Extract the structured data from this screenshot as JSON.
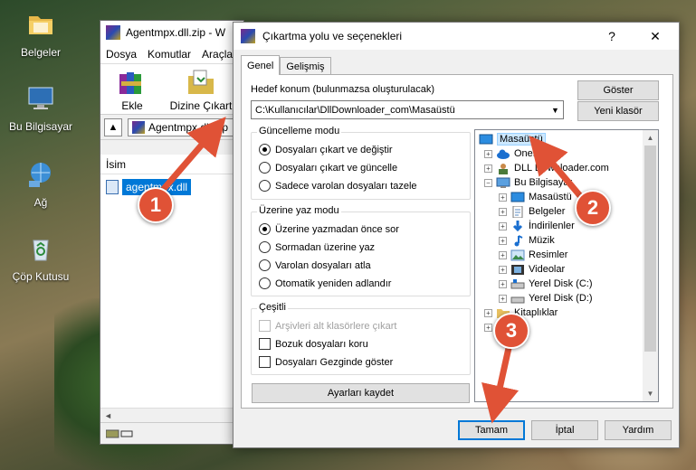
{
  "desktop": {
    "icons": [
      {
        "label": "Belgeler",
        "icon": "folder-icon"
      },
      {
        "label": "Bu Bilgisayar",
        "icon": "computer-icon"
      },
      {
        "label": "Ağ",
        "icon": "network-icon"
      },
      {
        "label": "Çöp Kutusu",
        "icon": "recycle-bin-icon"
      }
    ]
  },
  "winrar": {
    "title": "Agentmpx.dll.zip - W",
    "menu": [
      "Dosya",
      "Komutlar",
      "Araçla"
    ],
    "toolbar": {
      "add": "Ekle",
      "extract_to": "Dizine Çıkart"
    },
    "address": "Agentmpx.dll.zip",
    "list_header": "İsim",
    "file": "agentmpx.dll",
    "scroll_left": "◄"
  },
  "dialog": {
    "title": "Çıkartma yolu ve seçenekleri",
    "help_button": "?",
    "close_button": "✕",
    "tabs": [
      "Genel",
      "Gelişmiş"
    ],
    "destination_label": "Hedef konum (bulunmazsa oluşturulacak)",
    "destination_value": "C:\\Kullanıcılar\\DllDownloader_com\\Masaüstü",
    "show_button": "Göster",
    "new_folder_button": "Yeni klasör",
    "update_mode": {
      "legend": "Güncelleme modu",
      "options": [
        "Dosyaları çıkart ve değiştir",
        "Dosyaları çıkart ve güncelle",
        "Sadece varolan dosyaları tazele"
      ],
      "selected": 0
    },
    "overwrite_mode": {
      "legend": "Üzerine yaz modu",
      "options": [
        "Üzerine yazmadan önce sor",
        "Sormadan üzerine yaz",
        "Varolan dosyaları atla",
        "Otomatik yeniden adlandır"
      ],
      "selected": 0
    },
    "misc": {
      "legend": "Çeşitli",
      "options": [
        "Arşivleri alt klasörlere çıkart",
        "Bozuk dosyaları koru",
        "Dosyaları Gezginde göster"
      ],
      "disabled": [
        true,
        false,
        false
      ],
      "checked": [
        false,
        false,
        false
      ]
    },
    "save_settings_button": "Ayarları kaydet",
    "tree": [
      {
        "label": "Masaüstü",
        "selected": true
      },
      {
        "label": "OneDrive"
      },
      {
        "label": "DLL Downloader.com"
      },
      {
        "label": "Bu Bilgisayar"
      },
      {
        "label": "Masaüstü"
      },
      {
        "label": "Belgeler"
      },
      {
        "label": "İndirilenler"
      },
      {
        "label": "Müzik"
      },
      {
        "label": "Resimler"
      },
      {
        "label": "Videolar"
      },
      {
        "label": "Yerel Disk (C:)"
      },
      {
        "label": "Yerel Disk (D:)"
      },
      {
        "label": "Kitaplıklar"
      }
    ],
    "ok_button": "Tamam",
    "cancel_button": "İptal",
    "help_bottom_button": "Yardım"
  },
  "annotations": [
    "1",
    "2",
    "3"
  ],
  "colors": {
    "callout": "#e05236",
    "selection": "#0078d7"
  }
}
